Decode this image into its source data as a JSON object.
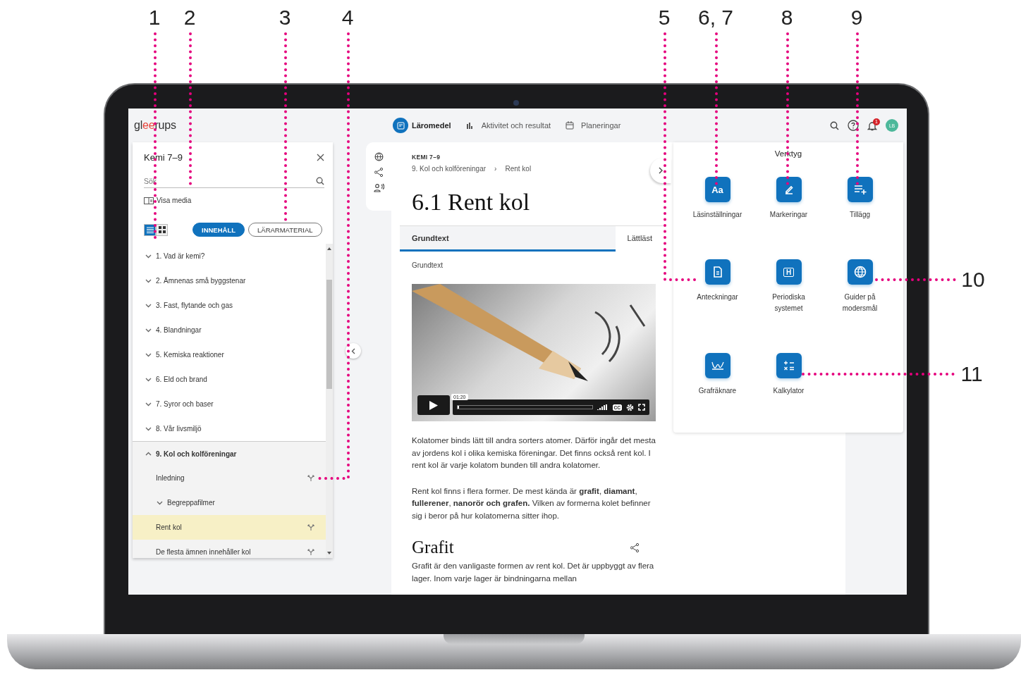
{
  "callouts": [
    {
      "label": "1"
    },
    {
      "label": "2"
    },
    {
      "label": "3"
    },
    {
      "label": "4"
    },
    {
      "label": "5"
    },
    {
      "label": "6, 7"
    },
    {
      "label": "8"
    },
    {
      "label": "9"
    },
    {
      "label": "10"
    },
    {
      "label": "11"
    }
  ],
  "topbar": {
    "logo": "gleerups",
    "nav": [
      {
        "label": "Läromedel",
        "kind": "book",
        "selected": true
      },
      {
        "label": "Aktivitet och resultat",
        "kind": "chart",
        "selected": false
      },
      {
        "label": "Planeringar",
        "kind": "calendar",
        "selected": false
      }
    ],
    "notification_count": "1",
    "avatar": "LB"
  },
  "sidebar": {
    "title": "Kemi 7–9",
    "search": {
      "placeholder": "Sök"
    },
    "media_toggle": "Visa media",
    "views": [
      {
        "kind": "list",
        "selected": true
      },
      {
        "kind": "grid",
        "selected": false
      }
    ],
    "filters": [
      {
        "label": "INNEHÅLL",
        "selected": true
      },
      {
        "label": "LÄRARMATERIAL",
        "selected": false
      }
    ],
    "items": [
      {
        "label": "1. Vad är kemi?",
        "expanded": false,
        "selected": false
      },
      {
        "label": "2. Ämnenas små byggstenar",
        "expanded": false,
        "selected": false
      },
      {
        "label": "3. Fast, flytande och gas",
        "expanded": false,
        "selected": false
      },
      {
        "label": "4. Blandningar",
        "expanded": false,
        "selected": false
      },
      {
        "label": "5. Kemiska reaktioner",
        "expanded": false,
        "selected": false
      },
      {
        "label": "6. Eld och brand",
        "expanded": false,
        "selected": false
      },
      {
        "label": "7. Syror och baser",
        "expanded": false,
        "selected": false
      },
      {
        "label": "8. Vår livsmiljö",
        "expanded": false,
        "selected": false
      },
      {
        "label": "9. Kol och kolföreningar",
        "expanded": true,
        "selected": false,
        "children": [
          {
            "label": "Inledning",
            "kind": "page",
            "selected": false
          },
          {
            "label": "Begreppafilmer",
            "kind": "group",
            "expanded": false,
            "selected": false
          },
          {
            "label": "Rent kol",
            "kind": "page",
            "selected": true
          },
          {
            "label": "De flesta ämnen innehåller kol",
            "kind": "page",
            "selected": false
          }
        ]
      }
    ]
  },
  "article": {
    "book": "KEMI 7–9",
    "breadcrumb": [
      "9. Kol och kolföreningar",
      "Rent kol"
    ],
    "breadcrumb_separator": "›",
    "title": "6.1 Rent kol",
    "tabs": [
      {
        "label": "Grundtext",
        "selected": true
      },
      {
        "label": "Lättläst",
        "selected": false
      }
    ],
    "section_label": "Grundtext",
    "video": {
      "time": "01:20",
      "captions": "CC"
    },
    "paragraphs": [
      "Kolatomer binds lätt till andra sorters atomer. Därför ingår det mesta av jordens kol i olika kemiska föreningar. Det finns också rent kol. I rent kol är varje kolatom bunden till andra kolatomer.",
      "Rent kol finns i flera former. De mest kända är **grafit**, **diamant**, **fullerener**, **nanorör och grafen.** Vilken av formerna kolet befinner sig i beror på hur kolatomerna sitter ihop."
    ],
    "heading": "Grafit",
    "heading_paragraph": "Grafit är den vanligaste formen av rent kol. Det är uppbyggt av flera lager. Inom varje lager är bindningarna mellan"
  },
  "tools": {
    "title": "Verktyg",
    "items": [
      {
        "label": "Läsinställningar",
        "kind": "text",
        "glyph": "Aa"
      },
      {
        "label": "Markeringar",
        "kind": "pen"
      },
      {
        "label": "Tillägg",
        "kind": "add"
      },
      {
        "label": "Anteckningar",
        "kind": "note"
      },
      {
        "label": "Periodiska systemet",
        "kind": "element",
        "glyph": "H"
      },
      {
        "label": "Guider på modersmål",
        "kind": "globe"
      },
      {
        "label": "Grafräknare",
        "kind": "graph"
      },
      {
        "label": "Kalkylator",
        "kind": "calc"
      }
    ]
  }
}
